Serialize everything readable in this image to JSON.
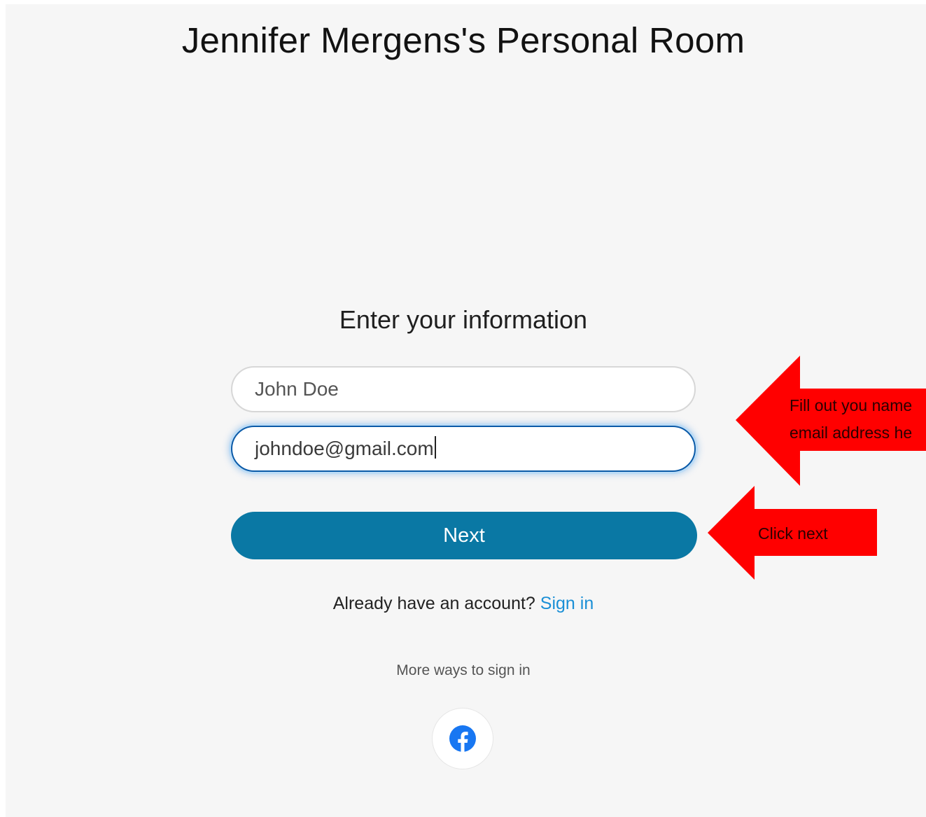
{
  "page": {
    "room_title": "Jennifer Mergens's Personal Room",
    "form_heading": "Enter your information"
  },
  "form": {
    "name_value": "John Doe",
    "email_value": "johndoe@gmail.com",
    "next_label": "Next"
  },
  "account": {
    "prompt": "Already have an account?",
    "signin_label": "Sign in"
  },
  "alt_signin": {
    "label": "More ways to sign in",
    "providers": [
      "facebook-icon"
    ]
  },
  "annotations": {
    "fields_note_line1": "Fill out you name",
    "fields_note_line2": "email address he",
    "next_note": "Click next",
    "color": "#ff0000"
  },
  "colors": {
    "primary_button": "#0a78a4",
    "link": "#1a8fd6",
    "background": "#f6f6f6"
  }
}
